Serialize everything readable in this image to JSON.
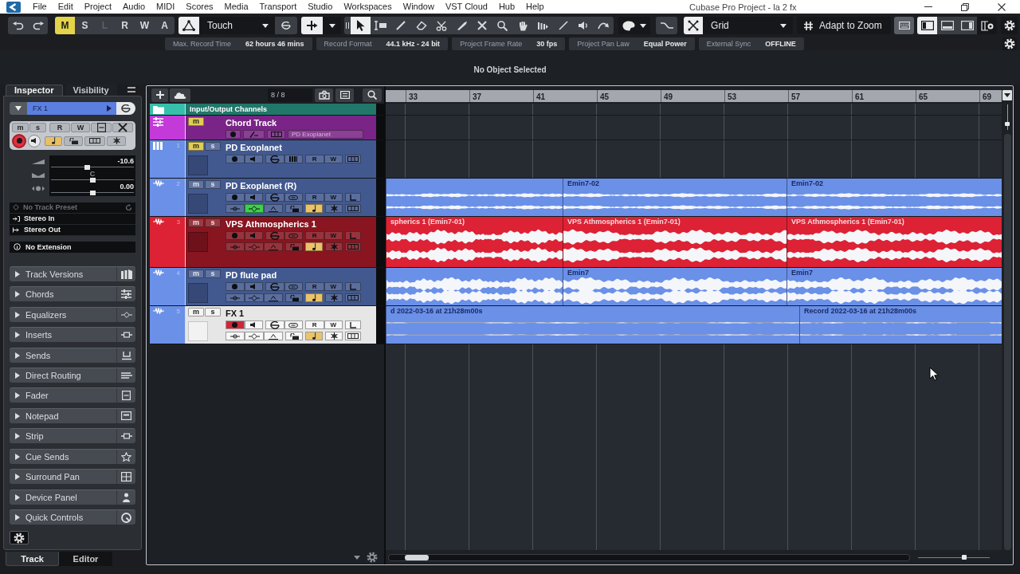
{
  "window": {
    "title": "Cubase Pro Project - la 2 fx"
  },
  "menu": [
    "File",
    "Edit",
    "Project",
    "Audio",
    "MIDI",
    "Scores",
    "Media",
    "Transport",
    "Studio",
    "Workspaces",
    "Window",
    "VST Cloud",
    "Hub",
    "Help"
  ],
  "toolbar": {
    "automation_buttons": [
      {
        "label": "M",
        "on": true,
        "disabled": false
      },
      {
        "label": "S",
        "on": false,
        "disabled": false
      },
      {
        "label": "L",
        "on": false,
        "disabled": true
      },
      {
        "label": "R",
        "on": false,
        "disabled": false
      },
      {
        "label": "W",
        "on": false,
        "disabled": false
      },
      {
        "label": "A",
        "on": false,
        "disabled": false
      }
    ],
    "automation_mode": "Touch",
    "tools": [
      {
        "kind": "object",
        "selected": true
      },
      {
        "kind": "range",
        "selected": false
      },
      {
        "kind": "pencil",
        "selected": false
      },
      {
        "kind": "eraser",
        "selected": false
      },
      {
        "kind": "scissors",
        "selected": false
      },
      {
        "kind": "glue",
        "selected": false
      },
      {
        "kind": "mute",
        "selected": false
      },
      {
        "kind": "zoom",
        "selected": false
      },
      {
        "kind": "hand",
        "selected": false
      },
      {
        "kind": "comp",
        "selected": false
      },
      {
        "kind": "line",
        "selected": false
      },
      {
        "kind": "speaker",
        "selected": false
      },
      {
        "kind": "warp",
        "selected": false
      }
    ],
    "snap_type": "Grid",
    "quantize": "Adapt to Zoom",
    "zones": [
      {
        "kind": "left",
        "selected": true
      },
      {
        "kind": "lower",
        "selected": false
      },
      {
        "kind": "right",
        "selected": false
      }
    ]
  },
  "info_line": [
    {
      "label": "Max. Record Time",
      "value": "62 hours 46 mins"
    },
    {
      "label": "Record Format",
      "value": "44.1 kHz - 24 bit"
    },
    {
      "label": "Project Frame Rate",
      "value": "30 fps"
    },
    {
      "label": "Project Pan Law",
      "value": "Equal Power"
    },
    {
      "label": "External Sync",
      "value": "OFFLINE"
    }
  ],
  "status": "No Object Selected",
  "inspector": {
    "tabs": [
      {
        "label": "Inspector",
        "selected": true
      },
      {
        "label": "Visibility",
        "selected": false
      }
    ],
    "track": {
      "name": "FX 1",
      "mute": {
        "label": "m",
        "on": false
      },
      "solo": {
        "label": "s",
        "on": false
      },
      "read": "R",
      "write": "W",
      "record": true,
      "timebase": true
    },
    "volume": {
      "reading": "-10.6",
      "level": 0.43
    },
    "pan": {
      "reading": "C",
      "level": 0.5
    },
    "delay": {
      "reading": "0.00",
      "level": 0.5
    },
    "routing": [
      {
        "label": "No Track Preset",
        "disabled": true
      },
      {
        "label": "Stereo In",
        "disabled": false
      },
      {
        "label": "Stereo Out",
        "disabled": false
      }
    ],
    "extension": "No Extension",
    "sections": [
      {
        "label": "Track Versions",
        "expanded": false
      },
      {
        "label": "Chords",
        "expanded": false
      },
      {
        "label": "Equalizers",
        "expanded": false
      },
      {
        "label": "Inserts",
        "expanded": false
      },
      {
        "label": "Sends",
        "expanded": false
      },
      {
        "label": "Direct Routing",
        "expanded": false
      },
      {
        "label": "Fader",
        "expanded": false
      },
      {
        "label": "Notepad",
        "expanded": false
      },
      {
        "label": "Strip",
        "expanded": false
      },
      {
        "label": "Cue Sends",
        "expanded": false
      },
      {
        "label": "Surround Pan",
        "expanded": false
      },
      {
        "label": "Device Panel",
        "expanded": false
      },
      {
        "label": "Quick Controls",
        "expanded": false
      }
    ],
    "bottom_tabs": [
      {
        "label": "Track",
        "selected": true
      },
      {
        "label": "Editor",
        "selected": false
      }
    ]
  },
  "track_list": {
    "count": "8 / 8",
    "tracks": [
      {
        "kind": "folder",
        "name": "Input/Output Channels",
        "color": "#36c0ab",
        "selected": false
      },
      {
        "kind": "chord",
        "name": "Chord Track",
        "color": "#c33ad8",
        "selected": false,
        "mute": {
          "label": "m",
          "on": true
        },
        "record": false,
        "instrument": "PD Exoplanet"
      },
      {
        "kind": "instrument",
        "name": "PD Exoplanet",
        "number": "1",
        "color": "#6a90e8",
        "selected": false,
        "mute": {
          "label": "m",
          "on": true
        },
        "solo": {
          "label": "s",
          "on": false
        },
        "record": false,
        "read": "R",
        "write": "W"
      },
      {
        "kind": "audio",
        "name": "PD Exoplanet (R)",
        "number": "2",
        "color": "#6a90e8",
        "selected": false,
        "mute": {
          "label": "m",
          "on": false
        },
        "solo": {
          "label": "s",
          "on": false
        },
        "record": false,
        "read": "R",
        "write": "W",
        "eq": true,
        "timebase": true,
        "events": [
          {
            "kind": "audio"
          },
          {
            "kind": "audio",
            "label": "Emin7-02"
          },
          {
            "kind": "audio",
            "label": "Emin7-02"
          }
        ]
      },
      {
        "kind": "audio",
        "name": "VPS Athmospherics 1",
        "number": "3",
        "color": "#dc2234",
        "selected": false,
        "mute": {
          "label": "m",
          "on": false
        },
        "solo": {
          "label": "s",
          "on": false
        },
        "record": false,
        "read": "R",
        "write": "W",
        "eq": false,
        "timebase": true,
        "events": [
          {
            "kind": "audio",
            "label": "spherics 1 (Emin7-01)"
          },
          {
            "kind": "audio",
            "label": "VPS Athmospherics 1 (Emin7-01)"
          },
          {
            "kind": "audio",
            "label": "VPS Athmospherics 1 (Emin7-01)"
          }
        ]
      },
      {
        "kind": "audio",
        "name": "PD flute pad",
        "number": "4",
        "color": "#6a90e8",
        "selected": false,
        "mute": {
          "label": "m",
          "on": false
        },
        "solo": {
          "label": "s",
          "on": false
        },
        "record": false,
        "read": "R",
        "write": "W",
        "eq": false,
        "timebase": true,
        "events": [
          {
            "kind": "audio"
          },
          {
            "kind": "audio",
            "label": "Emin7"
          },
          {
            "kind": "audio",
            "label": "Emin7"
          }
        ]
      },
      {
        "kind": "audio",
        "name": "FX 1",
        "number": "5",
        "color": "#6a90e8",
        "selected": true,
        "mute": {
          "label": "m",
          "on": false
        },
        "solo": {
          "label": "s",
          "on": false
        },
        "record": true,
        "read": "R",
        "write": "W",
        "eq": false,
        "timebase": true,
        "events": [
          {
            "kind": "audio",
            "label": "d 2022-03-16 at 21h28m00s"
          },
          {
            "kind": "audio",
            "label": "Record 2022-03-16 at 21h28m00s"
          }
        ]
      }
    ]
  },
  "arrange": {
    "ruler": [
      "33",
      "37",
      "41",
      "45",
      "49",
      "53",
      "57",
      "61",
      "65",
      "69"
    ],
    "vertical_zoom": {
      "level": 0.2
    },
    "horizontal_zoom": {
      "level": 0.65
    }
  }
}
